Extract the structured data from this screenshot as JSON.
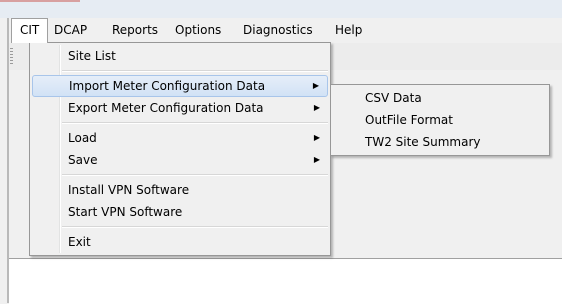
{
  "menubar": {
    "items": [
      "CIT",
      "DCAP",
      "Reports",
      "Options",
      "Diagnostics",
      "Help"
    ]
  },
  "cit_menu": {
    "site_list": "Site List",
    "import_meter": "Import Meter Configuration Data",
    "export_meter": "Export Meter Configuration Data",
    "load": "Load",
    "save": "Save",
    "install_vpn": "Install VPN Software",
    "start_vpn": "Start VPN Software",
    "exit": "Exit",
    "submenu_arrow": "▶"
  },
  "import_submenu": {
    "items": [
      "CSV Data",
      "OutFile Format",
      "TW2 Site Summary"
    ]
  },
  "colors": {
    "highlight": "#d1e2f6",
    "highlight_border": "#a8c5ea"
  }
}
